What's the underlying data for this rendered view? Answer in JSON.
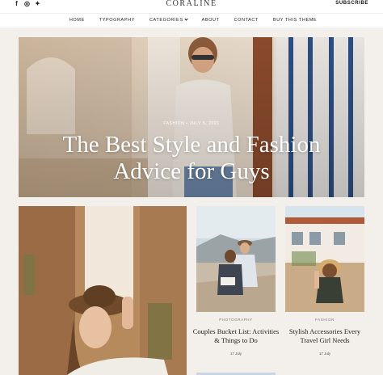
{
  "header": {
    "brand": "CORALINE",
    "subscribe_label": "SUBSCRIBE",
    "social": [
      {
        "icon": "facebook-icon",
        "glyph": "f"
      },
      {
        "icon": "instagram-icon",
        "glyph": "◎"
      },
      {
        "icon": "twitter-icon",
        "glyph": "✦"
      }
    ]
  },
  "nav": {
    "items": [
      "HOME",
      "TYPOGRAPHY",
      "CATEGORIES",
      "ABOUT",
      "CONTACT",
      "BUY THIS THEME"
    ]
  },
  "hero": {
    "meta": "FASHION • JULY 5, 2021",
    "title": "The Best Style and Fashion Advice for Guys"
  },
  "cards": [
    {
      "category": "PHOTOGRAPHY",
      "title": "Couples Bucket List: Activities & Things to Do",
      "date": "17 July"
    },
    {
      "category": "FASHION",
      "title": "Stylish Accessories Every Travel Girl Needs",
      "date": "17 July"
    }
  ],
  "colors": {
    "background": "#f3efea",
    "accent": "#222222"
  }
}
